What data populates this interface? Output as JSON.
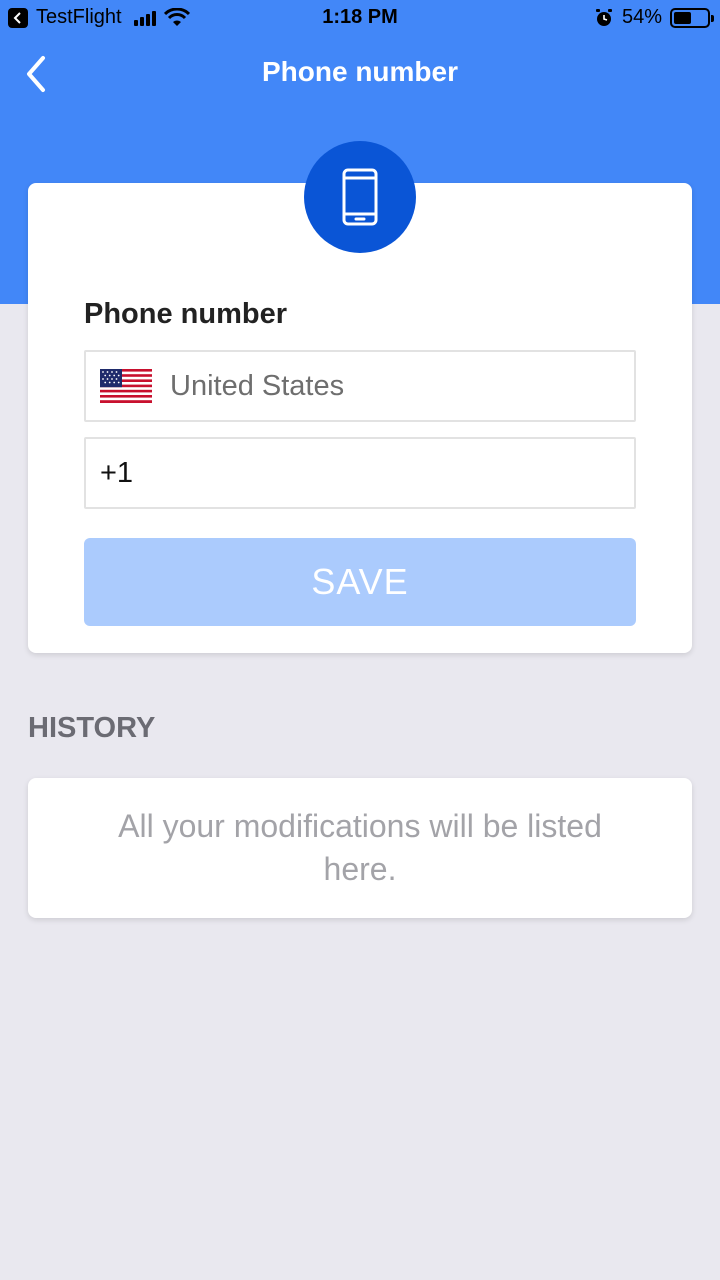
{
  "status_bar": {
    "app_name": "TestFlight",
    "time": "1:18 PM",
    "battery_percent": "54%",
    "battery_level": 0.54
  },
  "nav": {
    "title": "Phone number"
  },
  "form": {
    "label": "Phone number",
    "country": "United States",
    "country_flag": "us-flag-icon",
    "phone_value": "+1",
    "save_label": "SAVE"
  },
  "history": {
    "title": "HISTORY",
    "empty_message": "All your modifications will be listed here."
  },
  "colors": {
    "header_blue": "#4287f8",
    "badge_blue": "#0a55d6",
    "save_disabled": "#abcbfd",
    "background": "#e9e8ef"
  }
}
